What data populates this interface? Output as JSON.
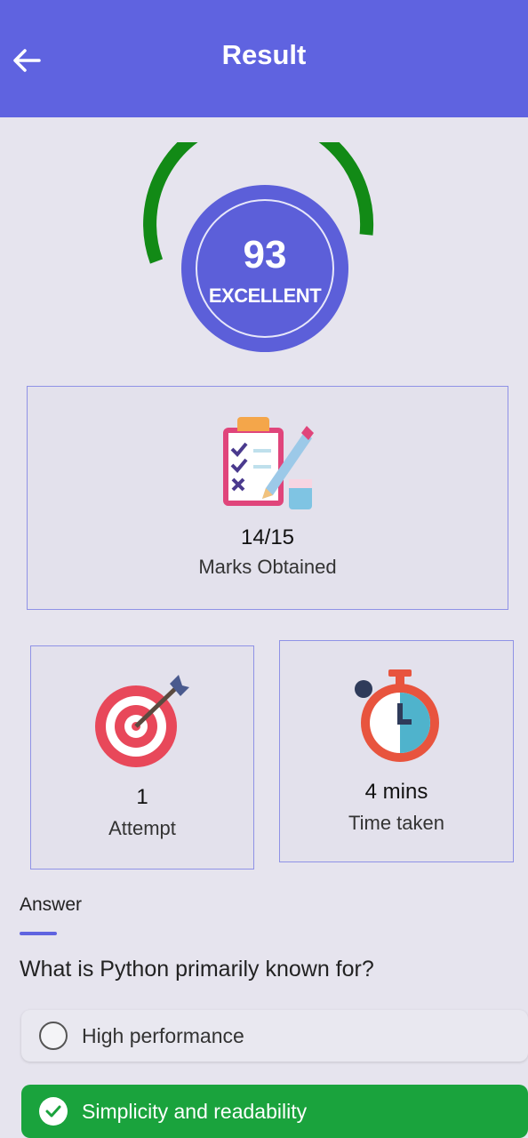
{
  "header": {
    "title": "Result"
  },
  "score": {
    "value": "93",
    "label": "EXCELLENT",
    "progress_fraction": 0.93,
    "arc_color": "#128a16",
    "circle_color": "#5c5fd9"
  },
  "cards": {
    "marks": {
      "value": "14/15",
      "label": "Marks Obtained",
      "icon": "clipboard-checklist-icon"
    },
    "attempt": {
      "value": "1",
      "label": "Attempt",
      "icon": "target-dart-icon"
    },
    "time": {
      "value": "4 mins",
      "label": "Time taken",
      "icon": "stopwatch-icon"
    }
  },
  "answer_section": {
    "title": "Answer",
    "question": "What is Python primarily known for?",
    "options": [
      {
        "text": "High performance",
        "selected": false
      },
      {
        "text": "Simplicity and readability",
        "selected": true
      }
    ]
  },
  "colors": {
    "header": "#5f63e0",
    "correct": "#1aa33d",
    "background": "#e6e4ee"
  }
}
